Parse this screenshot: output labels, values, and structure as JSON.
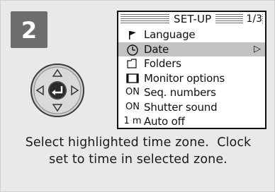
{
  "step_number": "2",
  "screen": {
    "title": "SET-UP",
    "page": "1/3",
    "menu": [
      {
        "label": "Language",
        "icon_text": "",
        "icon": "flag-icon",
        "selected": false
      },
      {
        "label": "Date",
        "icon_text": "",
        "icon": "clock-icon",
        "selected": true,
        "arrow": "▷"
      },
      {
        "label": "Folders",
        "icon_text": "",
        "icon": "folder-icon",
        "selected": false
      },
      {
        "label": "Monitor options",
        "icon_text": "",
        "icon": "monitor-icon",
        "selected": false
      },
      {
        "label": "Seq. numbers",
        "icon_text": "ON",
        "icon": "",
        "selected": false
      },
      {
        "label": "Shutter sound",
        "icon_text": "ON",
        "icon": "",
        "selected": false
      },
      {
        "label": "Auto off",
        "icon_text": "1 m",
        "icon": "",
        "selected": false
      }
    ]
  },
  "caption": {
    "line1": "Select highlighted time zone.  Clock",
    "line2": "set to time in selected zone."
  }
}
